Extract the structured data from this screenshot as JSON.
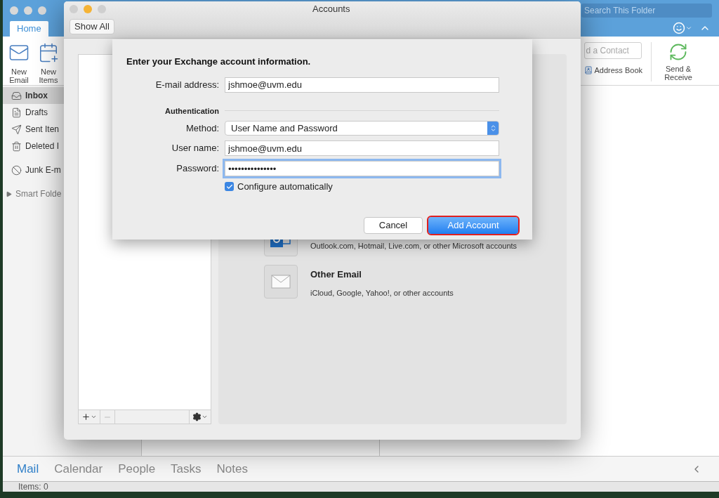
{
  "outlook": {
    "search": {
      "placeholder": "Search This Folder"
    },
    "tabs": [
      {
        "label": "Home",
        "selected": true
      }
    ],
    "ribbon_left": [
      {
        "label": "New Email",
        "kind": "mail"
      },
      {
        "label": "New Items",
        "kind": "items"
      }
    ],
    "contact_field": {
      "placeholder": "d a Contact"
    },
    "address_book": "Address Book",
    "send_receive": "Send & Receive",
    "folders": [
      {
        "label": "Inbox",
        "kind": "inbox",
        "selected": true
      },
      {
        "label": "Drafts",
        "kind": "drafts",
        "selected": false
      },
      {
        "label": "Sent Iten",
        "kind": "sent",
        "selected": false
      },
      {
        "label": "Deleted I",
        "kind": "deleted",
        "selected": false
      },
      {
        "label": "Junk E-m",
        "kind": "junk",
        "selected": false
      },
      {
        "label": "Smart Folde",
        "kind": "smart",
        "selected": false
      }
    ],
    "nav": [
      {
        "label": "Mail",
        "selected": true
      },
      {
        "label": "Calendar",
        "selected": false
      },
      {
        "label": "People",
        "selected": false
      },
      {
        "label": "Tasks",
        "selected": false
      },
      {
        "label": "Notes",
        "selected": false
      }
    ],
    "status": "Items: 0"
  },
  "accounts_window": {
    "title": "Accounts",
    "show_all": "Show All",
    "account_types": [
      {
        "kind": "outlook",
        "description": "Outlook.com, Hotmail, Live.com, or other Microsoft accounts"
      },
      {
        "kind": "other",
        "name": "Other Email",
        "description": "iCloud, Google, Yahoo!, or other accounts"
      }
    ]
  },
  "sheet": {
    "heading": "Enter your Exchange account information.",
    "email": {
      "label": "E-mail address:",
      "value": "jshmoe@uvm.edu"
    },
    "section": "Authentication",
    "method": {
      "label": "Method:",
      "value": "User Name and Password"
    },
    "username": {
      "label": "User name:",
      "value": "jshmoe@uvm.edu"
    },
    "password": {
      "label": "Password:",
      "value": "•••••••••••••••",
      "focused": true
    },
    "configure": {
      "label": "Configure automatically",
      "checked": true
    },
    "buttons": [
      {
        "label": "Cancel",
        "kind": "plain",
        "highlighted": false
      },
      {
        "label": "Add Account",
        "kind": "default",
        "highlighted": true
      }
    ]
  }
}
